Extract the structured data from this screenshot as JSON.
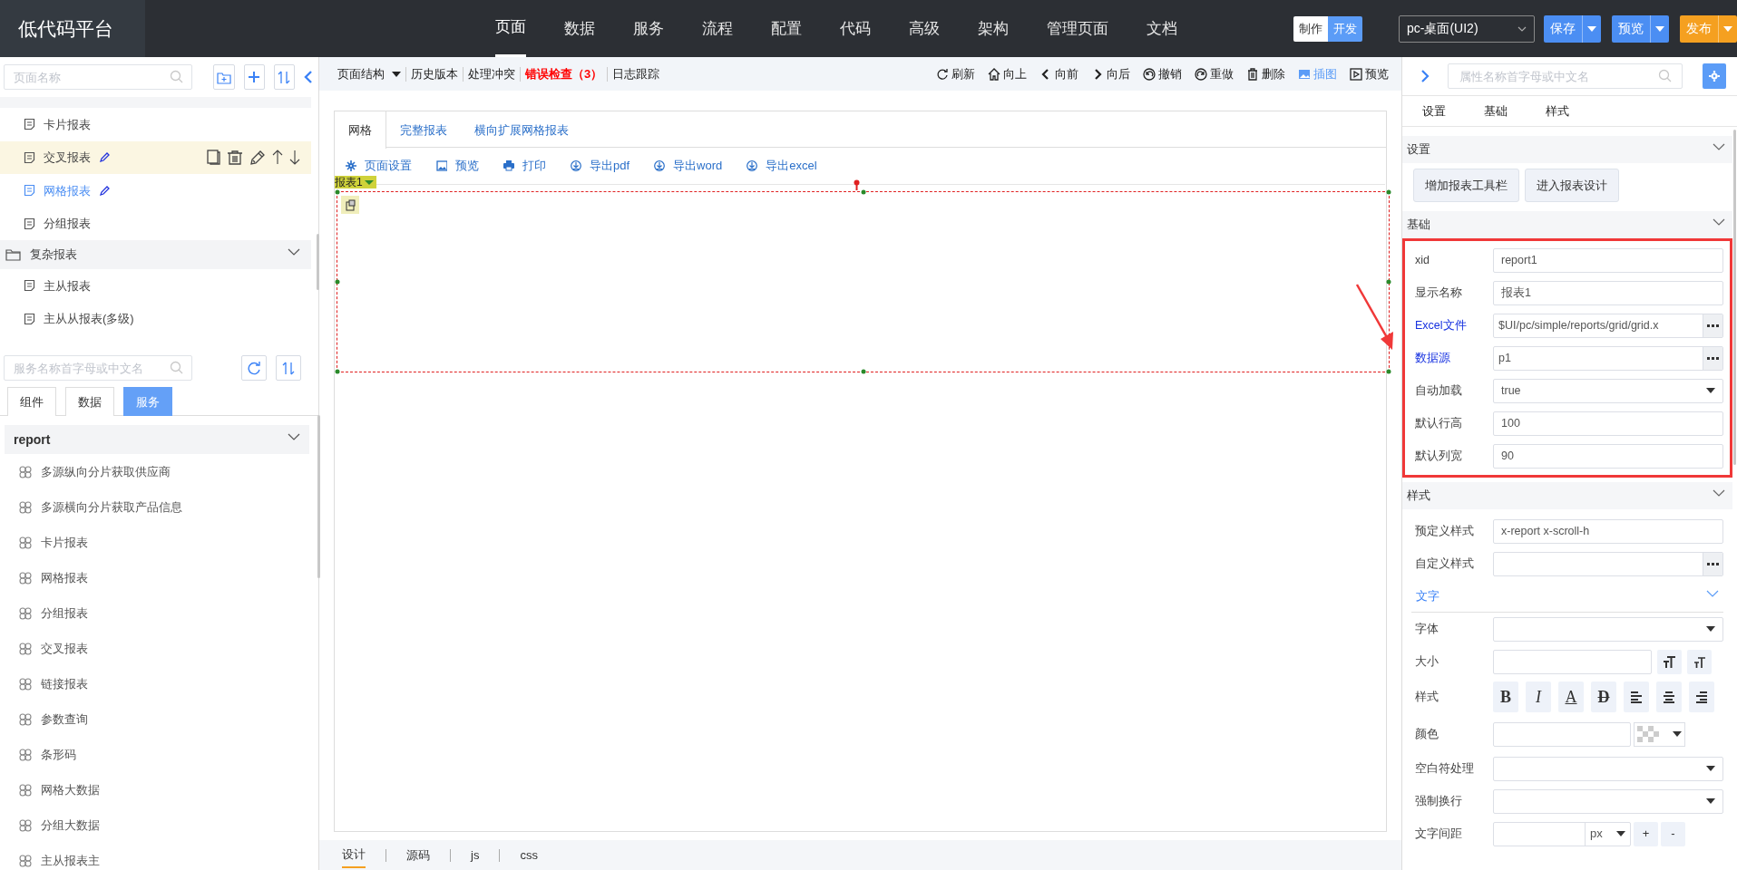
{
  "header": {
    "logo": "低代码平台",
    "nav": [
      {
        "label": "页面",
        "selected": true
      },
      {
        "label": "数据",
        "selected": false
      },
      {
        "label": "服务",
        "selected": false
      },
      {
        "label": "流程",
        "selected": false
      },
      {
        "label": "配置",
        "selected": false
      },
      {
        "label": "代码",
        "selected": false
      },
      {
        "label": "高级",
        "selected": false
      },
      {
        "label": "架构",
        "selected": false
      },
      {
        "label": "管理页面",
        "selected": false
      },
      {
        "label": "文档",
        "selected": false
      }
    ],
    "mode_switch": [
      {
        "label": "制作",
        "selected": true
      },
      {
        "label": "开发",
        "selected": false
      }
    ],
    "device_select": {
      "value": "pc-桌面(UI2)"
    },
    "actions": [
      {
        "label": "保存",
        "kind": "primary"
      },
      {
        "label": "预览",
        "kind": "primary"
      },
      {
        "label": "发布",
        "kind": "warning"
      }
    ]
  },
  "page_panel": {
    "search": {
      "placeholder": "页面名称"
    },
    "tree": [
      {
        "kind": "item",
        "label": "卡片报表",
        "selected": false,
        "hovered": false,
        "editable": false
      },
      {
        "kind": "item",
        "label": "交叉报表",
        "selected": false,
        "hovered": true,
        "editable": true
      },
      {
        "kind": "item",
        "label": "网格报表",
        "selected": true,
        "hovered": false,
        "editable": true
      },
      {
        "kind": "item",
        "label": "分组报表",
        "selected": false,
        "hovered": false,
        "editable": false
      },
      {
        "kind": "group",
        "label": "复杂报表",
        "expanded": true,
        "children": [
          {
            "kind": "item",
            "label": "主从报表",
            "selected": false,
            "hovered": false,
            "editable": false
          },
          {
            "kind": "item",
            "label": "主从从报表(多级)",
            "selected": false,
            "hovered": false,
            "editable": false
          }
        ]
      }
    ]
  },
  "service_panel": {
    "search": {
      "placeholder": "服务名称首字母或中文名"
    },
    "tabs": [
      {
        "label": "组件",
        "selected": false
      },
      {
        "label": "数据",
        "selected": false
      },
      {
        "label": "服务",
        "selected": true
      }
    ],
    "group": {
      "label": "report",
      "expanded": true,
      "items": [
        "多源纵向分片获取供应商",
        "多源横向分片获取产品信息",
        "卡片报表",
        "网格报表",
        "分组报表",
        "交叉报表",
        "链接报表",
        "参数查询",
        "条形码",
        "网格大数据",
        "分组大数据",
        "主从报表主"
      ]
    }
  },
  "editor": {
    "toolbar_left": [
      {
        "label": "页面结构",
        "kind": "menu"
      },
      {
        "label": "历史版本",
        "kind": "plain"
      },
      {
        "label": "处理冲突",
        "kind": "plain"
      },
      {
        "label": "错误检查（3）",
        "kind": "error"
      },
      {
        "label": "日志跟踪",
        "kind": "plain"
      }
    ],
    "toolbar_right": [
      {
        "label": "刷新",
        "active": false
      },
      {
        "label": "向上",
        "active": false
      },
      {
        "label": "向前",
        "active": false
      },
      {
        "label": "向后",
        "active": false
      },
      {
        "label": "撤销",
        "active": false
      },
      {
        "label": "重做",
        "active": false
      },
      {
        "label": "删除",
        "active": false
      },
      {
        "label": "插图",
        "active": true
      },
      {
        "label": "预览",
        "active": false
      }
    ],
    "tabs": [
      {
        "label": "网格",
        "selected": true
      },
      {
        "label": "完整报表",
        "selected": false
      },
      {
        "label": "横向扩展网格报表",
        "selected": false
      }
    ],
    "report_toolbar": [
      "页面设置",
      "预览",
      "打印",
      "导出pdf",
      "导出word",
      "导出excel"
    ],
    "report": {
      "label": "报表1",
      "selected": true
    },
    "bottom_tabs": [
      {
        "label": "设计",
        "selected": true
      },
      {
        "label": "源码",
        "selected": false
      },
      {
        "label": "js",
        "selected": false
      },
      {
        "label": "css",
        "selected": false
      }
    ]
  },
  "properties": {
    "search": {
      "placeholder": "属性名称首字母或中文名"
    },
    "tabs": [
      {
        "label": "设置",
        "selected": false
      },
      {
        "label": "基础",
        "selected": false
      },
      {
        "label": "样式",
        "selected": false
      }
    ],
    "sections": [
      {
        "title": "设置",
        "expanded": true,
        "kind": "buttons",
        "buttons": [
          "增加报表工具栏",
          "进入报表设计"
        ]
      },
      {
        "title": "基础",
        "expanded": true,
        "kind": "fields",
        "highlighted": true,
        "rows": [
          {
            "label": "xid",
            "kind": "text",
            "value": "report1",
            "linked": false
          },
          {
            "label": "显示名称",
            "kind": "text",
            "value": "报表1",
            "linked": false
          },
          {
            "label": "Excel文件",
            "kind": "picker",
            "value": "$UI/pc/simple/reports/grid/grid.x",
            "linked": true
          },
          {
            "label": "数据源",
            "kind": "picker",
            "value": "p1",
            "linked": true
          },
          {
            "label": "自动加载",
            "kind": "select",
            "value": "true",
            "linked": false
          },
          {
            "label": "默认行高",
            "kind": "text",
            "value": "100",
            "linked": false
          },
          {
            "label": "默认列宽",
            "kind": "text",
            "value": "90",
            "linked": false
          }
        ]
      },
      {
        "title": "样式",
        "expanded": true,
        "kind": "fields",
        "rows": [
          {
            "label": "预定义样式",
            "kind": "text",
            "value": "x-report x-scroll-h",
            "linked": false
          },
          {
            "label": "自定义样式",
            "kind": "picker",
            "linked": false
          },
          {
            "label": "文字",
            "kind": "subsection",
            "expanded": true
          },
          {
            "label": "字体",
            "kind": "select",
            "linked": false
          },
          {
            "label": "大小",
            "kind": "size",
            "linked": false
          },
          {
            "label": "样式",
            "kind": "format",
            "linked": false,
            "buttons": [
              {
                "label": "B",
                "kind": "bold"
              },
              {
                "label": "I",
                "kind": "italic"
              },
              {
                "label": "A",
                "kind": "underline"
              },
              {
                "label": "D",
                "kind": "strike"
              },
              {
                "kind": "align-left"
              },
              {
                "kind": "align-center"
              },
              {
                "kind": "align-right"
              }
            ]
          },
          {
            "label": "颜色",
            "kind": "color",
            "linked": false
          },
          {
            "label": "空白符处理",
            "kind": "select",
            "linked": false
          },
          {
            "label": "强制换行",
            "kind": "select",
            "linked": false
          },
          {
            "label": "文字间距",
            "kind": "unit",
            "linked": false,
            "unit": "px",
            "steps": [
              "+",
              "-"
            ]
          }
        ]
      }
    ]
  }
}
